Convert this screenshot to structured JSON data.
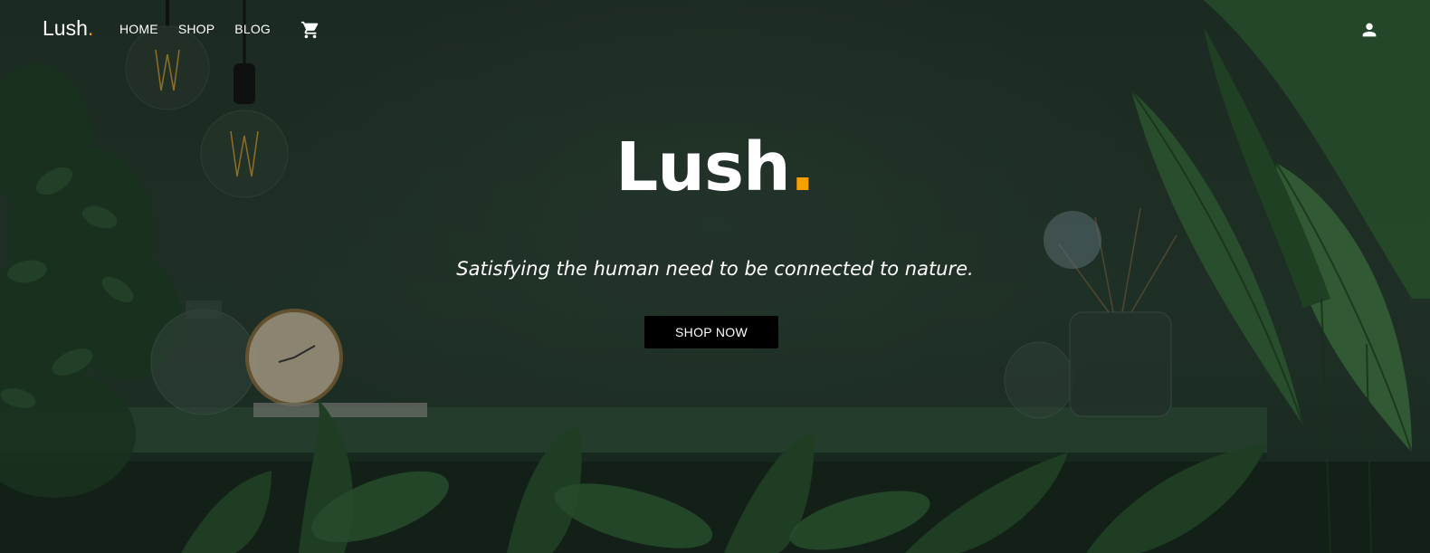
{
  "brand": {
    "name": "Lush",
    "dot": "."
  },
  "nav": {
    "links": [
      "HOME",
      "SHOP",
      "BLOG"
    ],
    "cart_icon": "cart-icon",
    "user_icon": "user-icon"
  },
  "hero": {
    "title": "Lush",
    "title_dot": ".",
    "subtitle": "Satisfying the human need to be connected to nature.",
    "cta_label": "SHOP NOW"
  },
  "colors": {
    "accent": "#f5a000",
    "text": "#ffffff",
    "button_bg": "#000000",
    "background": "#23352a"
  }
}
